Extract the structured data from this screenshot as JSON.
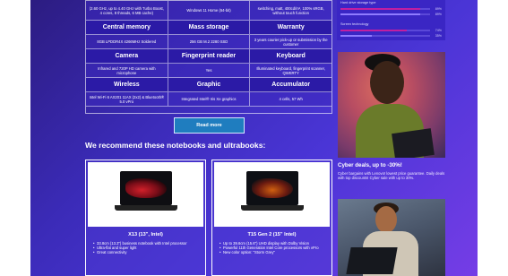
{
  "spec_table": {
    "rows": [
      {
        "type": "vals",
        "cells": [
          "(2.60 GHz, up to 4.40 GHz with Turbo Boost, 4 cores, 8 threads, 6 MB cache)",
          "Windows 11 Home (64-bit)",
          "switching, matt, 400cd/m², 100% sRGB, without touch function"
        ]
      },
      {
        "type": "heads",
        "cells": [
          "Central memory",
          "Mass storage",
          "Warranty"
        ]
      },
      {
        "type": "vals",
        "cells": [
          "8GB LPDDR4X 4266MHz Soldered",
          "256 GB M.2 2280 SSD",
          "3 years courier pick-up or submission by the customer"
        ]
      },
      {
        "type": "heads",
        "cells": [
          "Camera",
          "Fingerprint reader",
          "Keyboard"
        ]
      },
      {
        "type": "vals",
        "cells": [
          "Infrared and 720P HD camera with microphone",
          "Yes",
          "Illuminated keyboard, fingerprint scanner, QWERTY"
        ]
      },
      {
        "type": "heads",
        "cells": [
          "Wireless",
          "Graphic",
          "Accumulator"
        ]
      },
      {
        "type": "vals",
        "cells": [
          "Intel Wi-Fi 6 AX201 11AX (2x2) & Bluetooth® 5.0 vPro",
          "Integrated Intel® Iris Xe graphics",
          "4 cells, 57 Wh"
        ]
      }
    ]
  },
  "read_more_label": "Read more",
  "recommend_title": "We recommend these notebooks and ultrabooks:",
  "cards": [
    {
      "name": "X13 (13\", Intel)",
      "bullets": [
        "33.8cm (13.3\") business notebook with Intel processor",
        "Ultra-flat and super light",
        "Great connectivity"
      ]
    },
    {
      "name": "T15 Gen 2 (15\" Intel)",
      "bullets": [
        "Up to 39.6cm (15.6\") UHD display with Dolby Vision",
        "Powerful 11th Generation Intel Core processors with vPro",
        "New color option: \"Storm Grey\""
      ]
    }
  ],
  "sidebar": {
    "bars": [
      {
        "label": "Hard drive storage type",
        "pct": "89%",
        "value": 0.89,
        "color": "#c21fa0"
      },
      {
        "label": "",
        "pct": "89%",
        "value": 0.89,
        "color": "#8f7bff"
      },
      {
        "label": "Screen technology",
        "pct": "74%",
        "value": 0.74,
        "color": "#c21fa0"
      },
      {
        "label": "",
        "pct": "35%",
        "value": 0.35,
        "color": "#8f7bff"
      }
    ],
    "deal_title": "Cyber deals, up to -30%!",
    "deal_text": "Cyber bargains with Lenovo! lowest price guarantee. Daily deals with top discounts! Cyber sale with up to 30%."
  }
}
